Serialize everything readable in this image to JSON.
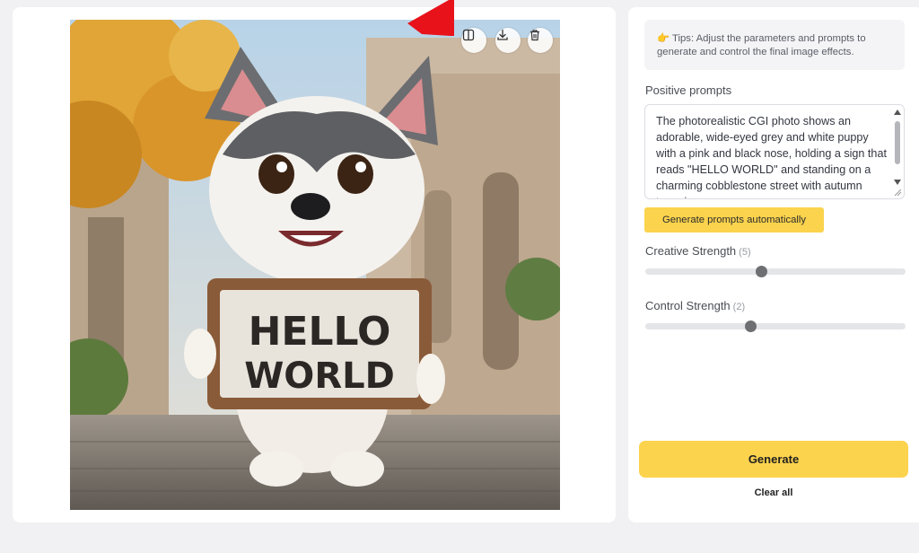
{
  "image_actions": [
    {
      "icon": "compare-icon"
    },
    {
      "icon": "download-icon"
    },
    {
      "icon": "trash-icon"
    }
  ],
  "sign_text": [
    "HELLO",
    "WORLD"
  ],
  "tips": {
    "emoji": "👉",
    "text": "Tips: Adjust the parameters and prompts to generate and control the final image effects."
  },
  "positive_prompts": {
    "label": "Positive prompts",
    "value": "The photorealistic CGI photo shows an adorable, wide-eyed grey and white puppy with a pink and black nose, holding a sign that reads \"HELLO WORLD\" and standing on a charming cobblestone street with autumn trees in"
  },
  "generate_prompts_button": "Generate prompts automatically",
  "creative_strength": {
    "label": "Creative Strength",
    "value_text": "(5)",
    "fraction": 0.445
  },
  "control_strength": {
    "label": "Control Strength",
    "value_text": "(2)",
    "fraction": 0.405
  },
  "generate_button": "Generate",
  "clear_button": "Clear all",
  "colors": {
    "accent": "#fcd34d",
    "arrow": "#e8121b"
  }
}
